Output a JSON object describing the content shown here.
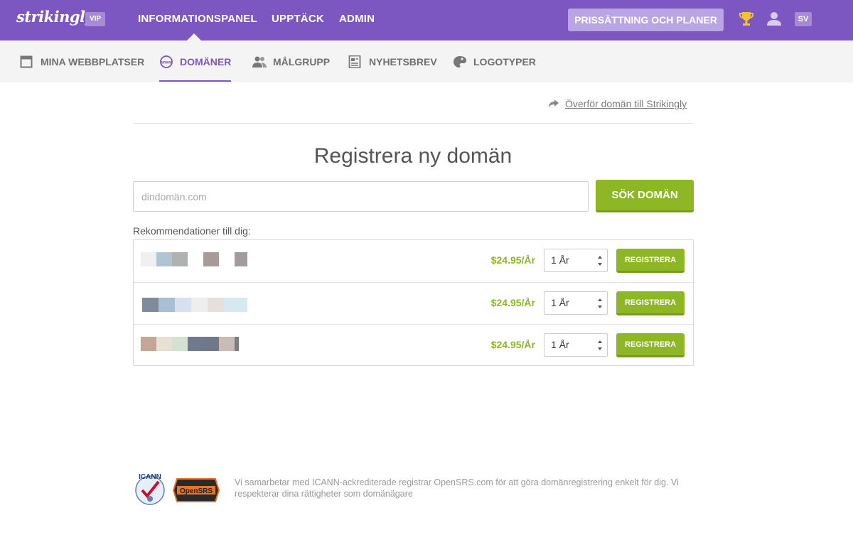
{
  "header": {
    "logo": "strikingly",
    "vip_badge": "VIP",
    "nav": [
      "INFORMATIONSPANEL",
      "UPPTÄCK",
      "ADMIN"
    ],
    "pricing_button": "PRISSÄTTNING OCH PLANER",
    "language": "SV"
  },
  "subnav": {
    "items": [
      {
        "label": "MINA WEBBPLATSER",
        "icon": "browser-window-icon"
      },
      {
        "label": "DOMÄNER",
        "icon": "www-globe-icon",
        "active": true
      },
      {
        "label": "MÅLGRUPP",
        "icon": "users-icon"
      },
      {
        "label": "NYHETSBREV",
        "icon": "newsletter-icon"
      },
      {
        "label": "LOGOTYPER",
        "icon": "palette-icon"
      }
    ]
  },
  "transfer_link": "Överför domän till Strikingly",
  "heading": "Registrera ny domän",
  "search": {
    "placeholder": "dindomän.com",
    "button": "SÖK DOMÄN"
  },
  "recommendations_label": "Rekommendationer till dig:",
  "recommendations": [
    {
      "price": "$24.95/År",
      "term": "1 År",
      "button": "REGISTRERA"
    },
    {
      "price": "$24.95/År",
      "term": "1 År",
      "button": "REGISTRERA"
    },
    {
      "price": "$24.95/År",
      "term": "1 År",
      "button": "REGISTRERA"
    }
  ],
  "footer": {
    "icann_text": "ICANN",
    "opensrs_text": "OpenSRS",
    "text": "Vi samarbetar med ICANN-ackrediterade registrar OpenSRS.com för att göra domänregistrering enkelt för dig. Vi respekterar dina rättigheter som domänägare"
  },
  "colors": {
    "brand_purple": "#7d57c1",
    "accent_green": "#8db725"
  }
}
